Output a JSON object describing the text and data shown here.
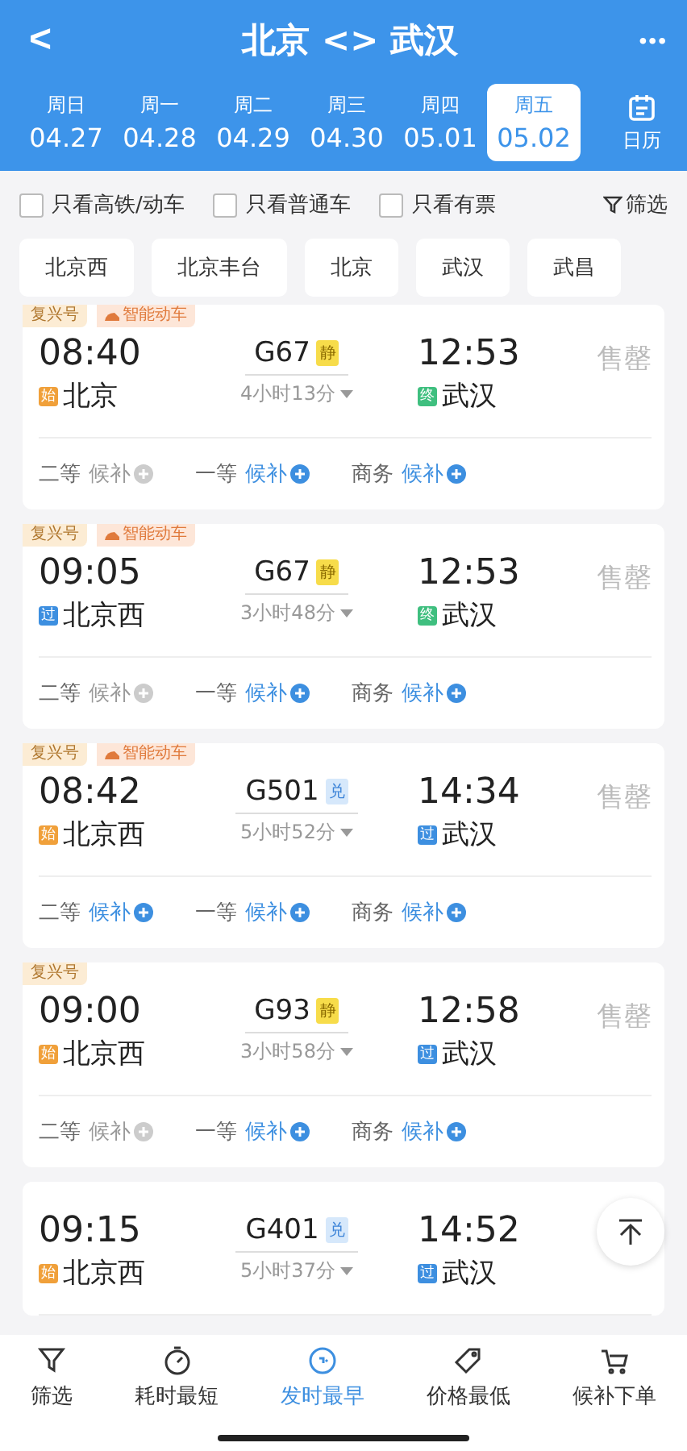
{
  "header": {
    "back": "<",
    "title": "北京 <> 武汉",
    "more": "•••"
  },
  "dates": [
    {
      "weekday": "周日",
      "date": "04.27",
      "selected": false
    },
    {
      "weekday": "周一",
      "date": "04.28",
      "selected": false
    },
    {
      "weekday": "周二",
      "date": "04.29",
      "selected": false
    },
    {
      "weekday": "周三",
      "date": "04.30",
      "selected": false
    },
    {
      "weekday": "周四",
      "date": "05.01",
      "selected": false
    },
    {
      "weekday": "周五",
      "date": "05.02",
      "selected": true
    }
  ],
  "calendar": {
    "label": "日历"
  },
  "filters": [
    {
      "label": "只看高铁/动车",
      "checked": false
    },
    {
      "label": "只看普通车",
      "checked": false
    },
    {
      "label": "只看有票",
      "checked": false
    }
  ],
  "filter_button": "筛选",
  "stations": [
    "北京西",
    "北京丰台",
    "北京",
    "武汉",
    "武昌"
  ],
  "trains": [
    {
      "tags": [
        {
          "kind": "plain",
          "text": "复兴号"
        },
        {
          "kind": "smart",
          "text": "智能动车"
        }
      ],
      "depart": "08:40",
      "number": "G67",
      "badge": {
        "kind": "quiet",
        "text": "静"
      },
      "arrive": "12:53",
      "status": "售罄",
      "from": {
        "kind": "origin",
        "mark": "始",
        "name": "北京"
      },
      "duration": "4小时13分",
      "to": {
        "kind": "terminal",
        "mark": "终",
        "name": "武汉"
      },
      "seats": [
        {
          "class": "二等",
          "action": "候补",
          "available": false
        },
        {
          "class": "一等",
          "action": "候补",
          "available": true
        },
        {
          "class": "商务",
          "action": "候补",
          "available": true
        }
      ]
    },
    {
      "tags": [
        {
          "kind": "plain",
          "text": "复兴号"
        },
        {
          "kind": "smart",
          "text": "智能动车"
        }
      ],
      "depart": "09:05",
      "number": "G67",
      "badge": {
        "kind": "quiet",
        "text": "静"
      },
      "arrive": "12:53",
      "status": "售罄",
      "from": {
        "kind": "pass",
        "mark": "过",
        "name": "北京西"
      },
      "duration": "3小时48分",
      "to": {
        "kind": "terminal",
        "mark": "终",
        "name": "武汉"
      },
      "seats": [
        {
          "class": "二等",
          "action": "候补",
          "available": false
        },
        {
          "class": "一等",
          "action": "候补",
          "available": true
        },
        {
          "class": "商务",
          "action": "候补",
          "available": true
        }
      ]
    },
    {
      "tags": [
        {
          "kind": "plain",
          "text": "复兴号"
        },
        {
          "kind": "smart",
          "text": "智能动车"
        }
      ],
      "depart": "08:42",
      "number": "G501",
      "badge": {
        "kind": "exchange",
        "text": "兑"
      },
      "arrive": "14:34",
      "status": "售罄",
      "from": {
        "kind": "origin",
        "mark": "始",
        "name": "北京西"
      },
      "duration": "5小时52分",
      "to": {
        "kind": "pass",
        "mark": "过",
        "name": "武汉"
      },
      "seats": [
        {
          "class": "二等",
          "action": "候补",
          "available": true
        },
        {
          "class": "一等",
          "action": "候补",
          "available": true
        },
        {
          "class": "商务",
          "action": "候补",
          "available": true
        }
      ]
    },
    {
      "tags": [
        {
          "kind": "plain",
          "text": "复兴号"
        }
      ],
      "depart": "09:00",
      "number": "G93",
      "badge": {
        "kind": "quiet",
        "text": "静"
      },
      "arrive": "12:58",
      "status": "售罄",
      "from": {
        "kind": "origin",
        "mark": "始",
        "name": "北京西"
      },
      "duration": "3小时58分",
      "to": {
        "kind": "pass",
        "mark": "过",
        "name": "武汉"
      },
      "seats": [
        {
          "class": "二等",
          "action": "候补",
          "available": false
        },
        {
          "class": "一等",
          "action": "候补",
          "available": true
        },
        {
          "class": "商务",
          "action": "候补",
          "available": true
        }
      ]
    },
    {
      "depart": "09:15",
      "number": "G401",
      "badge": {
        "kind": "exchange",
        "text": "兑"
      },
      "arrive": "14:52",
      "from": {
        "kind": "origin",
        "mark": "始",
        "name": "北京西"
      },
      "duration": "5小时37分",
      "to": {
        "kind": "pass",
        "mark": "过",
        "name": "武汉"
      }
    }
  ],
  "bottom_tabs": [
    {
      "kind": "filter",
      "label": "筛选",
      "selected": false
    },
    {
      "kind": "time",
      "label": "耗时最短",
      "selected": false
    },
    {
      "kind": "clock",
      "label": "发时最早",
      "selected": true
    },
    {
      "kind": "price",
      "label": "价格最低",
      "selected": false
    },
    {
      "kind": "cart",
      "label": "候补下单",
      "selected": false
    }
  ]
}
